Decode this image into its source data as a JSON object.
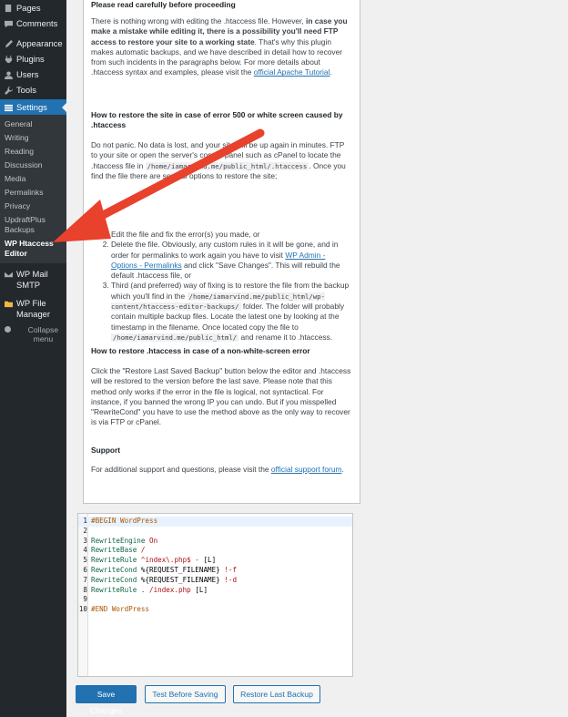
{
  "sidebar": {
    "top_items": [
      {
        "label": "Pages",
        "icon": "pages-icon"
      },
      {
        "label": "Comments",
        "icon": "comments-icon"
      },
      {
        "label": "Appearance",
        "icon": "appearance-icon"
      },
      {
        "label": "Plugins",
        "icon": "plugins-icon"
      },
      {
        "label": "Users",
        "icon": "users-icon"
      },
      {
        "label": "Tools",
        "icon": "tools-icon"
      }
    ],
    "settings_label": "Settings",
    "submenu": [
      "General",
      "Writing",
      "Reading",
      "Discussion",
      "Media",
      "Permalinks",
      "Privacy",
      "UpdraftPlus Backups",
      "WP Htaccess Editor"
    ],
    "after_items": [
      {
        "label": "WP Mail SMTP"
      },
      {
        "label": "WP File Manager"
      }
    ],
    "collapse_label": "Collapse menu"
  },
  "panel": {
    "heading_top": "Please read carefully before proceeding",
    "p1_a": "There is nothing wrong with editing the .htaccess file. However, ",
    "p1_bold": "in case you make a mistake while editing it, there is a possibility you'll need FTP access to restore your site to a working state",
    "p1_b": ". That's why this plugin makes automatic backups, and we have described in detail how to recover from such incidents in the paragraphs below. For more details about .htaccess syntax and examples, please visit the ",
    "p1_link": "official Apache Tutorial",
    "p1_end": ".",
    "h2": "How to restore the site in case of error 500 or white screen caused by .htaccess",
    "p2_a": "Do not panic. No data is lost, and your site will be up again in minutes. FTP to your site or open the server's control panel such as cPanel to locate the .htaccess file in ",
    "p2_code": "/home/iamarvind.me/public_html/.htaccess",
    "p2_b": ". Once you find the file there are several options to restore the site;",
    "li1_a": "Edit the file and fix the error(s) you made, or",
    "li2_a": "Delete the file. Obviously, any custom rules in it will be gone, and in order for permalinks to work again you have to visit ",
    "li2_link": "WP Admin - Options - Permalinks",
    "li2_b": " and click \"Save Changes\". This will rebuild the default .htaccess file, or",
    "li3_a": "Third (and preferred) way of fixing is to restore the file from the backup which you'll find in the ",
    "li3_code1": "/home/iamarvind.me/public_html/wp-content/htaccess-editor-backups/",
    "li3_b": " folder. The folder will probably contain multiple backup files. Locate the latest one by looking at the timestamp in the filename. Once located copy the file to ",
    "li3_code2": "/home/iamarvind.me/public_html/",
    "li3_c": " and rename it to .htaccess.",
    "h3": "How to restore .htaccess in case of a non-white-screen error",
    "p3": "Click the \"Restore Last Saved Backup\" button below the editor and .htaccess will be restored to the version before the last save. Please note that this method only works if the error in the file is logical, not syntactical. For instance, if you banned the wrong IP you can undo. But if you misspelled \"RewriteCond\" you have to use the method above as the only way to recover is via FTP or cPanel.",
    "h4": "Support",
    "p4_a": "For additional support and questions, please visit the ",
    "p4_link": "official support forum",
    "p4_end": "."
  },
  "editor": {
    "lines": [
      {
        "n": "1",
        "text": "#BEGIN WordPress",
        "kind": "comment"
      },
      {
        "n": "2",
        "text": "",
        "kind": "plain"
      },
      {
        "n": "3",
        "text": "RewriteEngine On",
        "kind": "directive"
      },
      {
        "n": "4",
        "text": "RewriteBase /",
        "kind": "directive"
      },
      {
        "n": "5",
        "text": "RewriteRule ^index\\.php$ - [L]",
        "kind": "directive"
      },
      {
        "n": "6",
        "text": "RewriteCond %{REQUEST_FILENAME} !-f",
        "kind": "directive"
      },
      {
        "n": "7",
        "text": "RewriteCond %{REQUEST_FILENAME} !-d",
        "kind": "directive"
      },
      {
        "n": "8",
        "text": "RewriteRule . /index.php [L]",
        "kind": "directive"
      },
      {
        "n": "9",
        "text": "",
        "kind": "plain"
      },
      {
        "n": "10",
        "text": "#END WordPress",
        "kind": "comment"
      }
    ]
  },
  "buttons": {
    "save": "Save Changes",
    "test": "Test Before Saving",
    "restore": "Restore Last Backup"
  },
  "colors": {
    "sidebar_bg": "#23282d",
    "accent": "#2271b1",
    "arrow": "#e8412c"
  }
}
